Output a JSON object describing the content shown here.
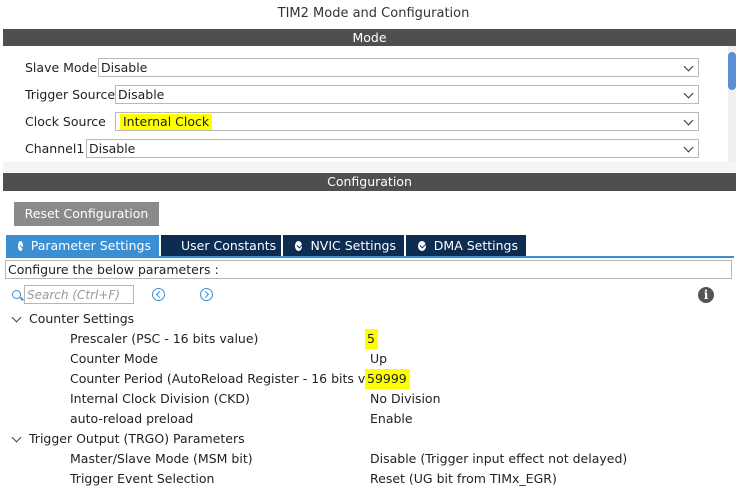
{
  "window_title": "TIM2 Mode and Configuration",
  "mode": {
    "header": "Mode",
    "fields": [
      {
        "label": "Slave Mode",
        "value": "Disable"
      },
      {
        "label": "Trigger Source",
        "value": "Disable"
      },
      {
        "label": "Clock Source",
        "value": "Internal Clock",
        "highlighted": true
      },
      {
        "label": "Channel1",
        "value": "Disable"
      }
    ]
  },
  "configuration": {
    "header": "Configuration",
    "reset_label": "Reset Configuration",
    "tabs": [
      {
        "label": "Parameter Settings",
        "active": true
      },
      {
        "label": "User Constants",
        "active": false
      },
      {
        "label": "NVIC Settings",
        "active": false
      },
      {
        "label": "DMA Settings",
        "active": false
      }
    ],
    "params_header": "Configure the below parameters :",
    "search_placeholder": "Search (Ctrl+F)",
    "groups": [
      {
        "title": "Counter Settings",
        "params": [
          {
            "name": "Prescaler (PSC - 16 bits value)",
            "value": "5",
            "highlighted": true
          },
          {
            "name": "Counter Mode",
            "value": "Up"
          },
          {
            "name": "Counter Period (AutoReload Register - 16 bits val...",
            "value": "59999",
            "highlighted": true
          },
          {
            "name": "Internal Clock Division (CKD)",
            "value": "No Division"
          },
          {
            "name": "auto-reload preload",
            "value": "Enable"
          }
        ]
      },
      {
        "title": "Trigger Output (TRGO) Parameters",
        "params": [
          {
            "name": "Master/Slave Mode (MSM bit)",
            "value": "Disable (Trigger input effect not delayed)"
          },
          {
            "name": "Trigger Event Selection",
            "value": "Reset (UG bit from TIMx_EGR)"
          }
        ]
      }
    ]
  },
  "colors": {
    "section_bar": "#4f4f4f",
    "tab_active": "#3b8ed1",
    "tab_inactive": "#0c2c52",
    "highlight": "#ffff00",
    "reset_button": "#8a8a8a"
  }
}
